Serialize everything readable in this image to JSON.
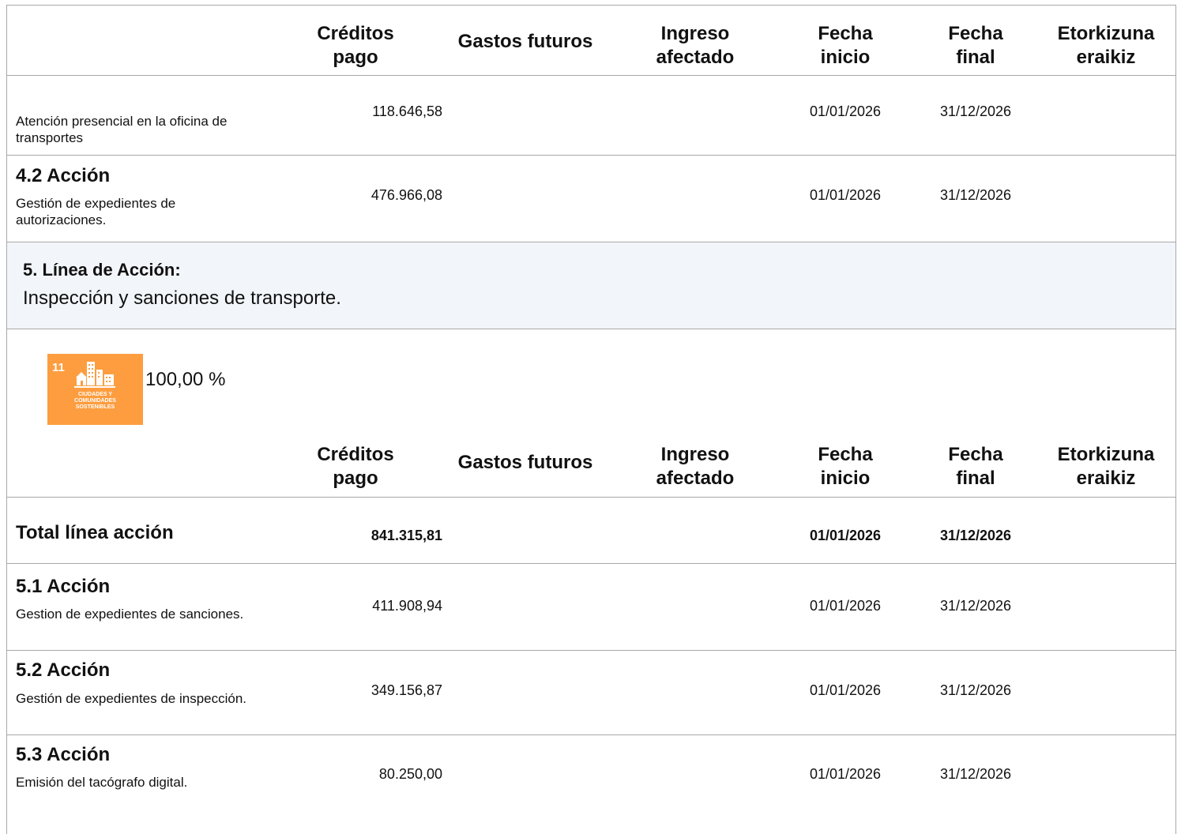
{
  "header_labels": {
    "creditos": "Créditos pago",
    "gastos": "Gastos futuros",
    "ingreso": "Ingreso afectado",
    "fecha_inicio": "Fecha inicio",
    "fecha_final": "Fecha final",
    "etorkizuna": "Etorkizuna eraikiz"
  },
  "header_lines": {
    "creditos": [
      "Créditos",
      "pago"
    ],
    "gastos": [
      "Gastos futuros"
    ],
    "ingreso": [
      "Ingreso",
      "afectado"
    ],
    "fecha_inicio": [
      "Fecha",
      "inicio"
    ],
    "fecha_final": [
      "Fecha",
      "final"
    ],
    "etorkizuna": [
      "Etorkizuna",
      "eraikiz"
    ]
  },
  "prev_rows": [
    {
      "title": "",
      "description": "Atención presencial en la oficina de transportes",
      "creditos": "118.646,58",
      "fecha_inicio": "01/01/2026",
      "fecha_final": "31/12/2026"
    },
    {
      "title": "4.2 Acción",
      "description": "Gestión de expedientes de autorizaciones.",
      "creditos": "476.966,08",
      "fecha_inicio": "01/01/2026",
      "fecha_final": "31/12/2026"
    }
  ],
  "linea": {
    "title": "5. Línea de Acción:",
    "description": "Inspección y sanciones de transporte."
  },
  "ods": {
    "number": "11",
    "label_lines": [
      "CIUDADES Y",
      "COMUNIDADES",
      "SOSTENIBLES"
    ],
    "percentage": "100,00 %",
    "color": "#fd9d3f",
    "icon": "city-buildings-icon"
  },
  "total_row": {
    "label": "Total línea acción",
    "creditos": "841.315,81",
    "fecha_inicio": "01/01/2026",
    "fecha_final": "31/12/2026"
  },
  "actions": [
    {
      "title": "5.1 Acción",
      "description": "Gestion de expedientes de sanciones.",
      "creditos": "411.908,94",
      "fecha_inicio": "01/01/2026",
      "fecha_final": "31/12/2026"
    },
    {
      "title": "5.2 Acción",
      "description": "Gestión de expedientes de inspección.",
      "creditos": "349.156,87",
      "fecha_inicio": "01/01/2026",
      "fecha_final": "31/12/2026"
    },
    {
      "title": "5.3 Acción",
      "description": "Emisión del tacógrafo digital.",
      "creditos": "80.250,00",
      "fecha_inicio": "01/01/2026",
      "fecha_final": "31/12/2026"
    }
  ],
  "colors": {
    "border": "#a8a8a8",
    "linea_background": "#f2f6fb",
    "ods_badge": "#fd9d3f"
  }
}
